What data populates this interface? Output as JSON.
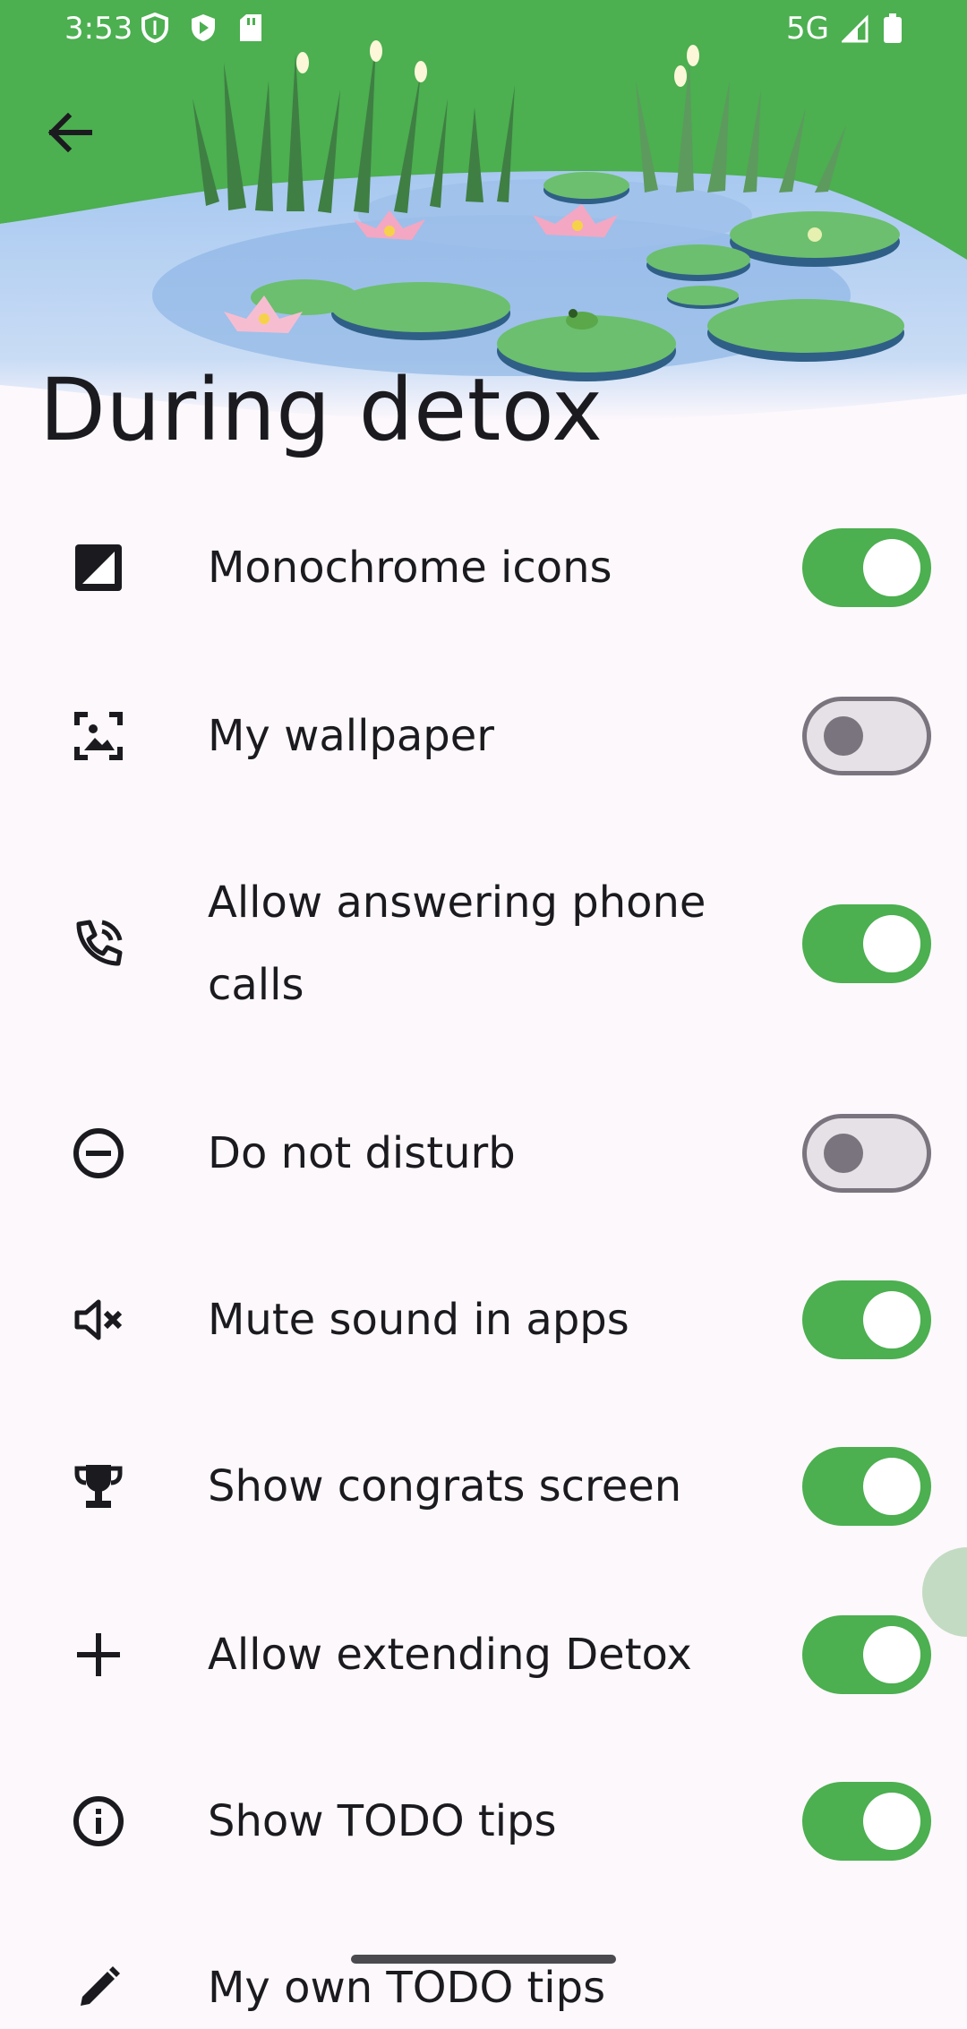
{
  "status_bar": {
    "time": "3:53",
    "network": "5G",
    "icons_left": [
      "shield-icon",
      "play-icon",
      "sd-card-icon"
    ],
    "icons_right": [
      "signal-icon",
      "battery-icon"
    ]
  },
  "header": {
    "back_icon": "arrow-left-icon",
    "title": "During detox",
    "illustration": "pond-with-lily-pads"
  },
  "colors": {
    "accent": "#4caf50",
    "background": "#fdf8fc",
    "switch_off_track": "#e6e1e6",
    "switch_off_outline": "#79747e"
  },
  "settings": [
    {
      "label": "Monochrome icons",
      "icon": "monochrome-icon",
      "enabled": true
    },
    {
      "label": "My wallpaper",
      "icon": "wallpaper-icon",
      "enabled": false
    },
    {
      "label": "Allow answering phone calls",
      "icon": "phone-call-icon",
      "enabled": true
    },
    {
      "label": "Do not disturb",
      "icon": "do-not-disturb-icon",
      "enabled": false
    },
    {
      "label": "Mute sound in apps",
      "icon": "mute-icon",
      "enabled": true
    },
    {
      "label": "Show congrats screen",
      "icon": "trophy-icon",
      "enabled": true
    },
    {
      "label": "Allow extending Detox",
      "icon": "plus-icon",
      "enabled": true
    },
    {
      "label": "Show TODO tips",
      "icon": "info-icon",
      "enabled": true
    },
    {
      "label": "My own TODO tips",
      "icon": "pencil-icon"
    }
  ]
}
